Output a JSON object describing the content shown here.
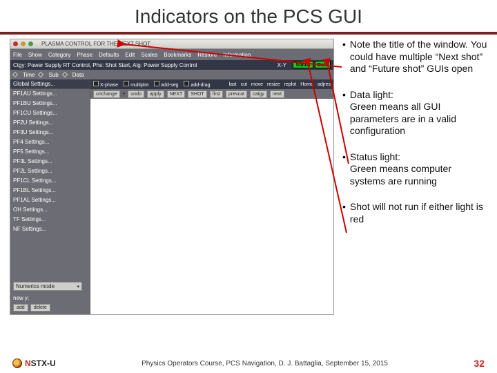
{
  "slide": {
    "title": "Indicators on the PCS GUI",
    "page_number": "32",
    "footer": "Physics Operators Course, PCS Navigation, D. J. Battaglia, September 15, 2015",
    "logo_text_n": "N",
    "logo_text_rest": "STX-U"
  },
  "gui": {
    "window_title": "PLASMA CONTROL FOR THE NEXT SHOT",
    "menubar": [
      "File",
      "Show",
      "Category",
      "Phase",
      "Defaults",
      "Edit",
      "Scales",
      "Bookmarks",
      "Restore",
      "Information"
    ],
    "ctgy_line": "Ctgy: Power Supply RT Control, Phs: Shot Start, Alg: Power Supply Control",
    "xy_label": "X-Y",
    "status_label": "Status",
    "data_label": "Data",
    "row2": {
      "time": "Time",
      "sub": "Sub",
      "data": "Data"
    },
    "opt1": {
      "xphase": "X-phase",
      "mult": "multiplot",
      "addseg": "add-seg",
      "adddrag": "add-drag",
      "right": [
        "last",
        "cut",
        "move",
        "resize",
        "replot",
        "Home",
        "adjres"
      ]
    },
    "opt2": {
      "left_label": "unchange",
      "buttons": [
        "undo",
        "apply",
        "NEXT",
        "SHOT",
        "first",
        "prevcat",
        "catgy",
        "next"
      ]
    },
    "sidebar": {
      "header": "Global Settings...",
      "items": [
        "PF1AU Settings...",
        "PF1BU Settings...",
        "PF1CU Settings...",
        "PF2U Settings...",
        "PF3U Settings...",
        "PF4 Settings...",
        "PF5 Settings...",
        "PF3L Settings...",
        "PF2L Settings...",
        "PF1CL Settings...",
        "PF1BL Settings...",
        "PF1AL Settings...",
        "OH Settings...",
        "TF Settings...",
        "NF Settings..."
      ],
      "combo": "Numerics mode",
      "new_label": "new y:",
      "btn_add": "add",
      "btn_delete": "delete"
    }
  },
  "notes": [
    "Note the title of the window. You could have multiple “Next shot” and “Future shot” GUIs open",
    "Data light:\nGreen means all GUI parameters are in a valid configuration",
    "Status light:\nGreen means computer systems are running",
    "Shot will not run if either light is red"
  ]
}
